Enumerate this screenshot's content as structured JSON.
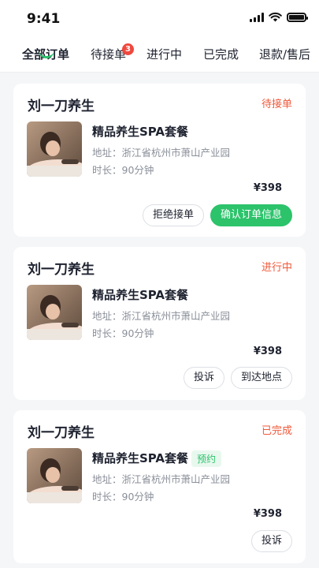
{
  "status_bar": {
    "time": "9:41"
  },
  "tabs": [
    {
      "label": "全部订单"
    },
    {
      "label": "待接单",
      "badge": "3"
    },
    {
      "label": "进行中"
    },
    {
      "label": "已完成"
    },
    {
      "label": "退款/售后"
    }
  ],
  "orders": [
    {
      "shop": "刘一刀养生",
      "status": "待接单",
      "product": "精品养生SPA套餐",
      "address_label": "地址：",
      "address": "浙江省杭州市萧山产业园",
      "duration_label": "时长：",
      "duration": "90分钟",
      "price": "¥398",
      "buttons": [
        "拒绝接单",
        "确认订单信息"
      ]
    },
    {
      "shop": "刘一刀养生",
      "status": "进行中",
      "product": "精品养生SPA套餐",
      "address_label": "地址：",
      "address": "浙江省杭州市萧山产业园",
      "duration_label": "时长：",
      "duration": "90分钟",
      "price": "¥398",
      "buttons": [
        "投诉",
        "到达地点"
      ]
    },
    {
      "shop": "刘一刀养生",
      "status": "已完成",
      "product": "精品养生SPA套餐",
      "tag": "预约",
      "address_label": "地址：",
      "address": "浙江省杭州市萧山产业园",
      "duration_label": "时长：",
      "duration": "90分钟",
      "price": "¥398",
      "buttons": [
        "投诉"
      ]
    }
  ],
  "colors": {
    "accent": "#2cc36b",
    "status": "#f0583a",
    "badge": "#f0483e"
  }
}
